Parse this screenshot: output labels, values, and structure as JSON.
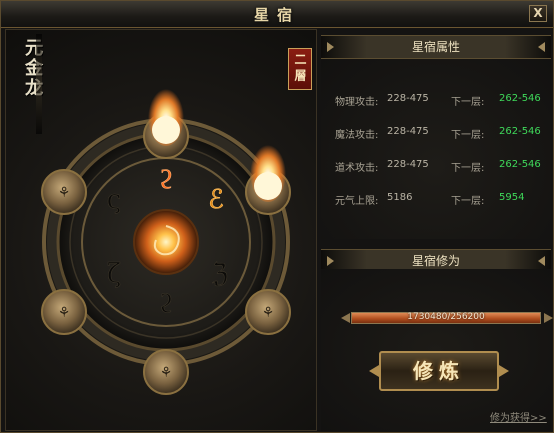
{
  "window": {
    "title": "星宿",
    "close_label": "X"
  },
  "left": {
    "name_deco": "元金龙",
    "layer_badge": "二層"
  },
  "attributes": {
    "header": "星宿属性",
    "rows": [
      {
        "label": "物理攻击:",
        "value": "228-475",
        "next_label": "下一层:",
        "next_value": "262-546"
      },
      {
        "label": "魔法攻击:",
        "value": "228-475",
        "next_label": "下一层:",
        "next_value": "262-546"
      },
      {
        "label": "道术攻击:",
        "value": "228-475",
        "next_label": "下一层:",
        "next_value": "262-546"
      },
      {
        "label": "元气上限:",
        "value": "5186",
        "next_label": "下一层:",
        "next_value": "5954"
      }
    ]
  },
  "cultivation": {
    "header": "星宿修为",
    "progress_text": "1730480/256200",
    "progress_fraction": 1.0,
    "button_label": "修炼",
    "get_link": "修为获得>>"
  },
  "colors": {
    "accent_green": "#3fd85a",
    "gold": "#b08d4f",
    "badge_red": "#8a1d12"
  }
}
